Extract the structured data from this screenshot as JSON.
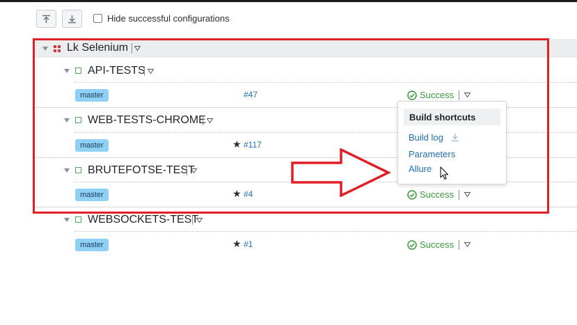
{
  "toolbar": {
    "collapse_all_icon": "collapse-up-icon",
    "expand_all_icon": "expand-down-icon",
    "hide_successful_label": "Hide successful configurations",
    "hide_successful_checked": false
  },
  "project": {
    "name": "Lk Selenium",
    "icon": "project-grid-icon"
  },
  "configurations": [
    {
      "name": "API-TESTS",
      "branch": "master",
      "starred": false,
      "build": "#47",
      "status": "Success"
    },
    {
      "name": "WEB-TESTS-CHROME",
      "branch": "master",
      "starred": true,
      "build": "#117",
      "status": ""
    },
    {
      "name": "BRUTEFOTSE-TEST",
      "branch": "master",
      "starred": true,
      "build": "#4",
      "status": "Success"
    },
    {
      "name": "WEBSOCKETS-TEST",
      "branch": "master",
      "starred": true,
      "build": "#1",
      "status": "Success"
    }
  ],
  "popup": {
    "title": "Build shortcuts",
    "items": [
      "Build log",
      "Parameters",
      "Allure"
    ]
  },
  "colors": {
    "annotation_red": "#e01f26",
    "branch_badge": "#8ed0f6",
    "success_green": "#3a9a3f",
    "link_blue": "#1f6fb5"
  }
}
